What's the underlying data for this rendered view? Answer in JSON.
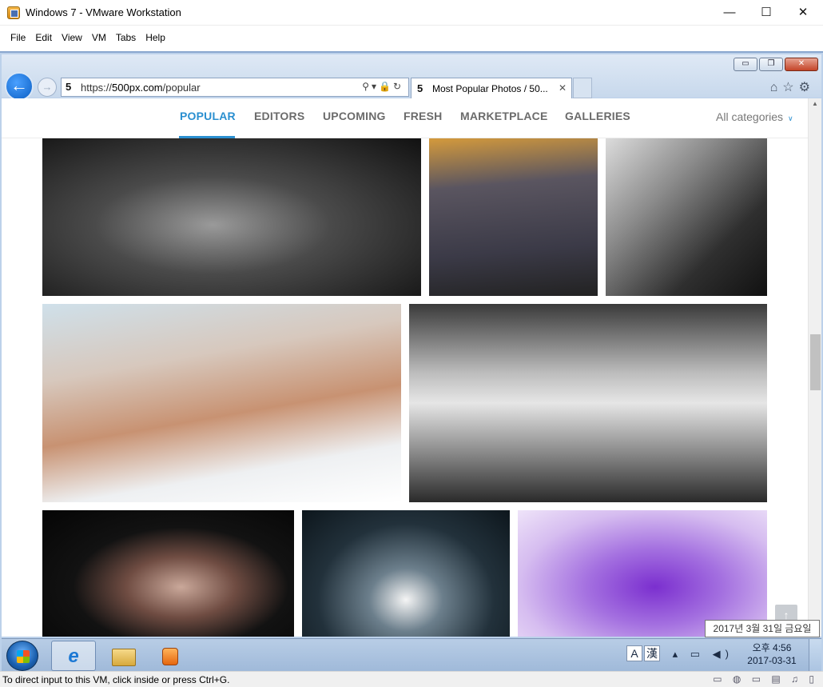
{
  "host": {
    "title": "Windows 7 - VMware Workstation",
    "controls": {
      "minimize": "—",
      "maximize": "☐",
      "close": "✕"
    },
    "menu": [
      "File",
      "Edit",
      "View",
      "VM",
      "Tabs",
      "Help"
    ],
    "status_message": "To direct input to this VM, click inside or press Ctrl+G.",
    "device_icons": "▭ ◍ ▭ ▤ ♫ ▯"
  },
  "ie": {
    "window_controls": {
      "minimize": "▭",
      "restore": "❐",
      "close": "✕"
    },
    "address": {
      "site_icon": "5",
      "url_scheme": "https://",
      "url_host": "500px.com",
      "url_path": "/popular",
      "tools": "⚲▾🔒↻"
    },
    "tab": {
      "icon": "5",
      "title": "Most Popular Photos / 50...",
      "close": "✕"
    },
    "right_icons": "⌂☆⚙",
    "back_glyph": "←",
    "forward_glyph": "→"
  },
  "page": {
    "nav": [
      {
        "label": "POPULAR",
        "active": true
      },
      {
        "label": "EDITORS"
      },
      {
        "label": "UPCOMING"
      },
      {
        "label": "FRESH"
      },
      {
        "label": "MARKETPLACE"
      },
      {
        "label": "GALLERIES"
      }
    ],
    "all_categories": "All categories",
    "all_categories_chevron": "∨",
    "scroll_top_glyph": "↑",
    "photos": [
      "flower-butterfly-bw",
      "rocky-beach-sunset",
      "woman-lying-bw",
      "woman-portrait-white-fur",
      "lighthouse-long-exposure-bw",
      "woman-dark-hood",
      "tunnel-light-trails",
      "purple-crocus"
    ]
  },
  "tooltip": "2017년 3월 31일 금요일",
  "taskbar": {
    "ie_glyph": "e",
    "ime_a": "A",
    "ime_han": "漢",
    "tray_icons": "▴ ▭ ◀)",
    "time": "오후 4:56",
    "date": "2017-03-31"
  }
}
